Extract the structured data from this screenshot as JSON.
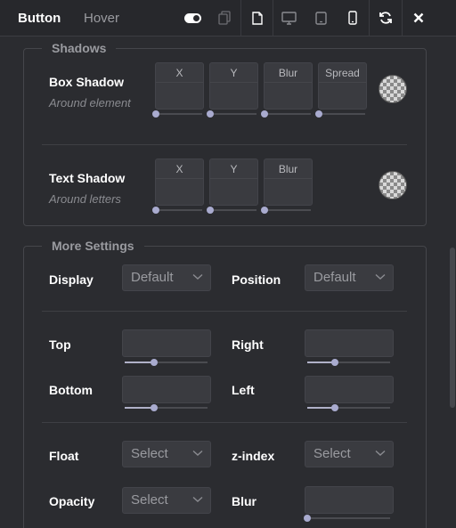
{
  "tabs": {
    "active": "Button",
    "inactive": "Hover"
  },
  "toolbar": {
    "icons": [
      "toggle-icon",
      "copy-icon",
      "page-icon",
      "desktop-icon",
      "tablet-icon",
      "mobile-icon",
      "refresh-icon",
      "close-icon"
    ]
  },
  "shadows": {
    "legend": "Shadows",
    "box": {
      "title": "Box Shadow",
      "subtitle": "Around element",
      "fields": [
        "X",
        "Y",
        "Blur",
        "Spread"
      ]
    },
    "text": {
      "title": "Text Shadow",
      "subtitle": "Around letters",
      "fields": [
        "X",
        "Y",
        "Blur"
      ]
    }
  },
  "more": {
    "legend": "More Settings",
    "display": {
      "label": "Display",
      "value": "Default"
    },
    "position": {
      "label": "Position",
      "value": "Default"
    },
    "top": {
      "label": "Top",
      "slider": 0.35
    },
    "right": {
      "label": "Right",
      "slider": 0.33
    },
    "bottom": {
      "label": "Bottom",
      "slider": 0.35
    },
    "left": {
      "label": "Left",
      "slider": 0.33
    },
    "float": {
      "label": "Float",
      "value": "Select"
    },
    "zindex": {
      "label": "z-index",
      "value": "Select"
    },
    "opacity": {
      "label": "Opacity",
      "value": "Select"
    },
    "blur": {
      "label": "Blur",
      "slider": 0.0
    }
  },
  "colors": {
    "bg": "#2b2c30",
    "accent": "#a9abcf"
  }
}
